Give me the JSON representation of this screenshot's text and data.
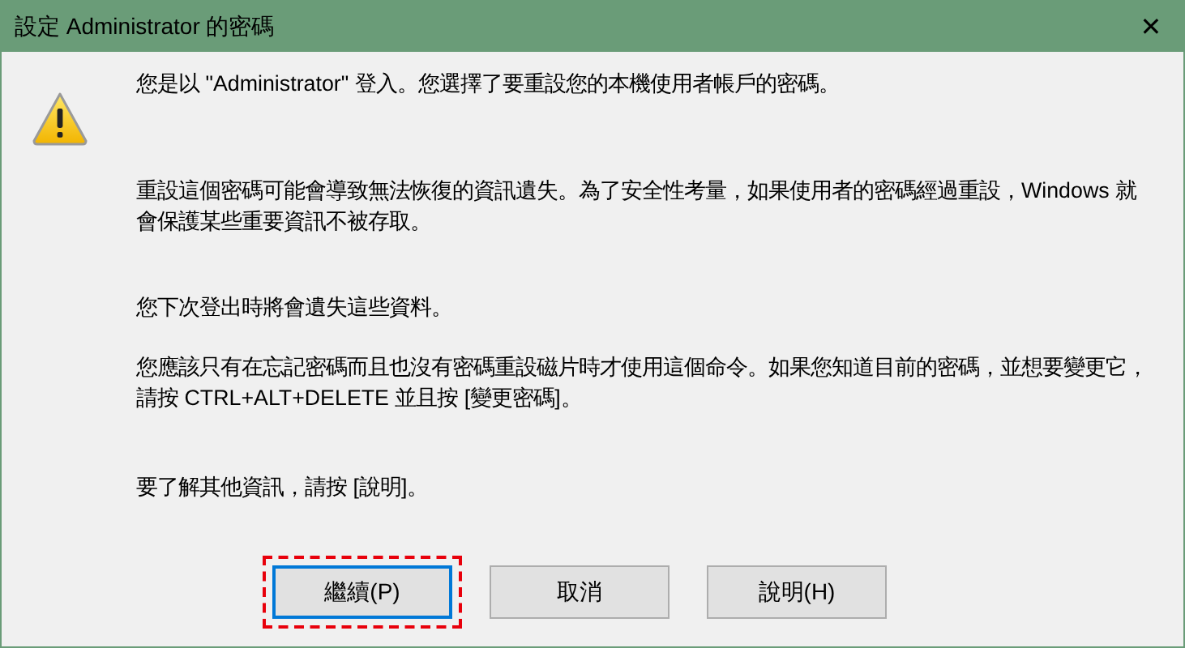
{
  "window": {
    "title": "設定 Administrator 的密碼",
    "close": "✕"
  },
  "paragraphs": [
    "您是以 \"Administrator\" 登入。您選擇了要重設您的本機使用者帳戶的密碼。",
    "重設這個密碼可能會導致無法恢復的資訊遺失。為了安全性考量，如果使用者的密碼經過重設，Windows 就會保護某些重要資訊不被存取。",
    "您下次登出時將會遺失這些資料。",
    "您應該只有在忘記密碼而且也沒有密碼重設磁片時才使用這個命令。如果您知道目前的密碼，並想要變更它，請按 CTRL+ALT+DELETE 並且按 [變更密碼]。",
    "要了解其他資訊，請按 [說明]。"
  ],
  "buttons": [
    {
      "label": "繼續(P)",
      "selected": true,
      "highlighted": true
    },
    {
      "label": "取消",
      "selected": false,
      "highlighted": false
    },
    {
      "label": "說明(H)",
      "selected": false,
      "highlighted": false
    }
  ]
}
